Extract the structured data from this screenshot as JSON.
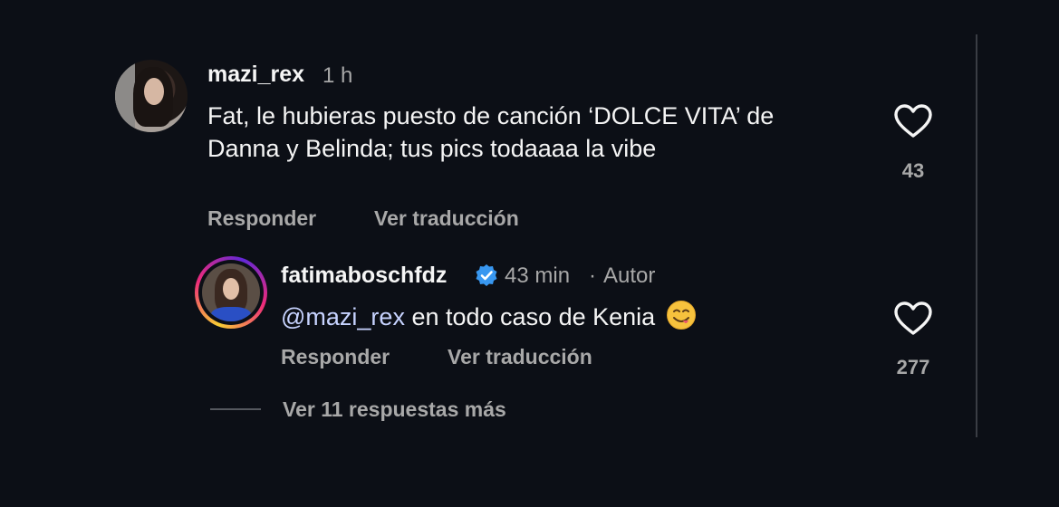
{
  "comments": [
    {
      "username": "mazi_rex",
      "time": "1 h",
      "text": "Fat, le hubieras puesto de canción ‘DOLCE VITA’ de Danna y Belinda; tus pics todaaaa la vibe",
      "reply_label": "Responder",
      "translate_label": "Ver traducción",
      "likes": "43"
    }
  ],
  "reply": {
    "username": "fatimaboschfdz",
    "verified": true,
    "time": "43 min",
    "separator": "·",
    "role": "Autor",
    "mention": "@mazi_rex",
    "text": "en todo caso de Kenia",
    "emoji": "yum-face-icon",
    "reply_label": "Responder",
    "translate_label": "Ver traducción",
    "likes": "277"
  },
  "more_replies": "Ver 11 respuestas más",
  "colors": {
    "background": "#0c0f16",
    "text": "#f5f5f5",
    "secondary": "#a8a8a8",
    "mention": "#c7d3ff",
    "verified": "#3897f0"
  }
}
